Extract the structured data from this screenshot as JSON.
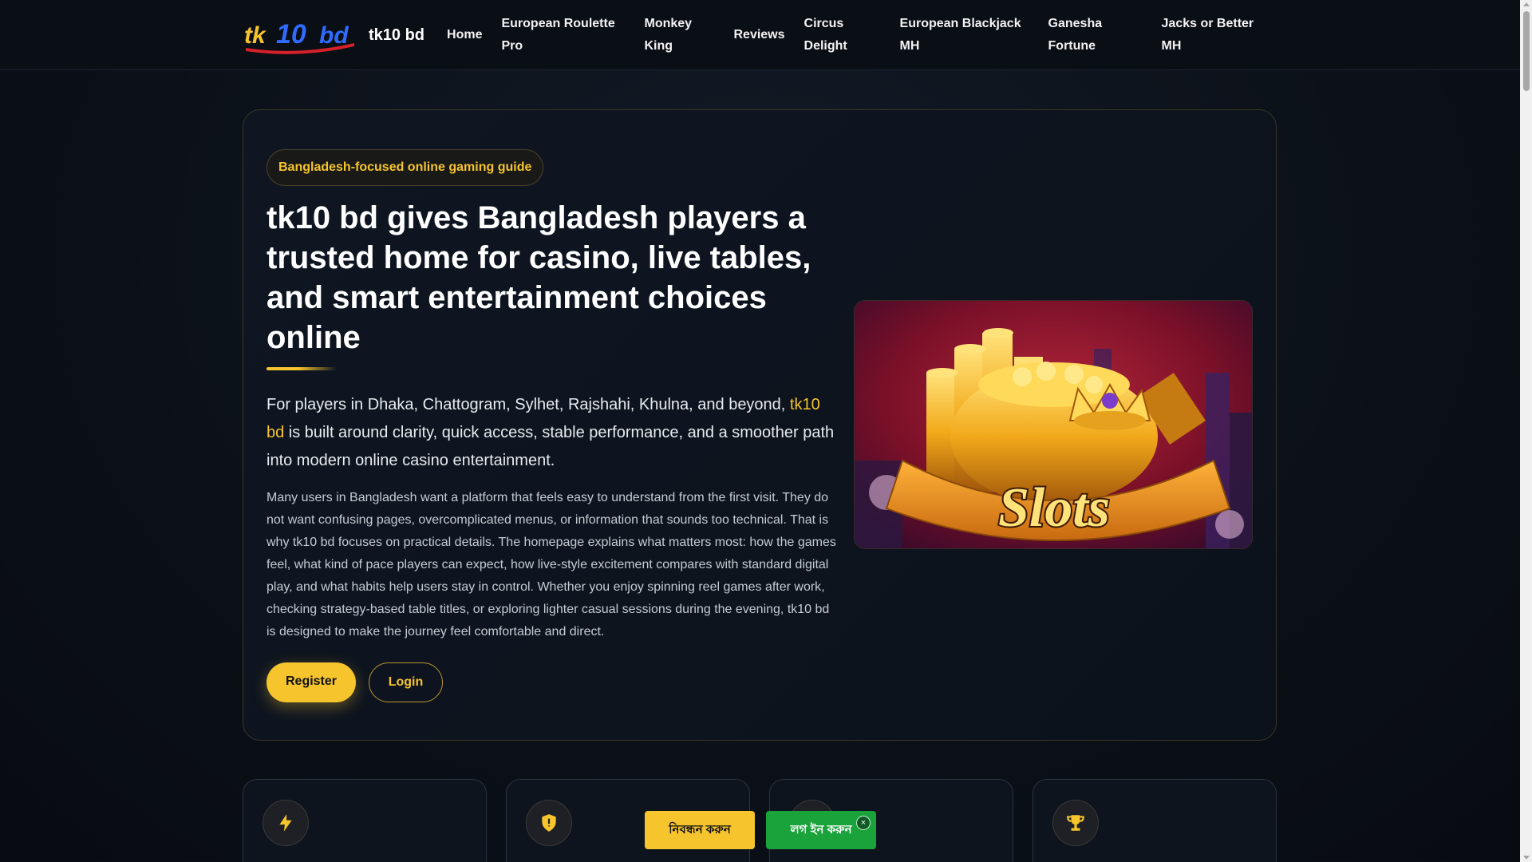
{
  "header": {
    "site_name": "tk10 bd",
    "logo_text_1": "tk",
    "logo_text_2": "10",
    "logo_text_3": "bd",
    "nav": [
      "Home",
      "European Roulette Pro",
      "Monkey King",
      "Reviews",
      "Circus Delight",
      "European Blackjack MH",
      "Ganesha Fortune",
      "Jacks or Better MH"
    ]
  },
  "hero": {
    "badge": "Bangladesh-focused online gaming guide",
    "title": "tk10 bd gives Bangladesh players a trusted home for casino, live tables, and smart entertainment choices online",
    "lead_before": "For players in Dhaka, Chattogram, Sylhet, Rajshahi, Khulna, and beyond, ",
    "lead_link": "tk10 bd",
    "lead_after": " is built around clarity, quick access, stable performance, and a smoother path into modern online casino entertainment.",
    "body": "Many users in Bangladesh want a platform that feels easy to understand from the first visit. They do not want confusing pages, overcomplicated menus, or information that sounds too technical. That is why tk10 bd focuses on practical details. The homepage explains what matters most: how the games feel, what kind of pace players can expect, how live-style excitement compares with standard digital play, and what habits help users stay in control. Whether you enjoy spinning reel games after work, checking strategy-based table titles, or exploring lighter casual sessions during the evening, tk10 bd is designed to make the journey feel comfortable and direct.",
    "register_label": "Register",
    "login_label": "Login",
    "image_text": "Slots"
  },
  "features": [
    {
      "icon": "lightning-icon"
    },
    {
      "icon": "shield-icon"
    },
    {
      "icon": "star-icon"
    },
    {
      "icon": "trophy-icon"
    }
  ],
  "floating": {
    "register_label": "নিবন্ধন করুন",
    "login_label": "লগ ইন করুন",
    "close_label": "×"
  },
  "colors": {
    "accent": "#f6c42d",
    "background": "#0b1018",
    "float_login": "#1aa33b"
  }
}
